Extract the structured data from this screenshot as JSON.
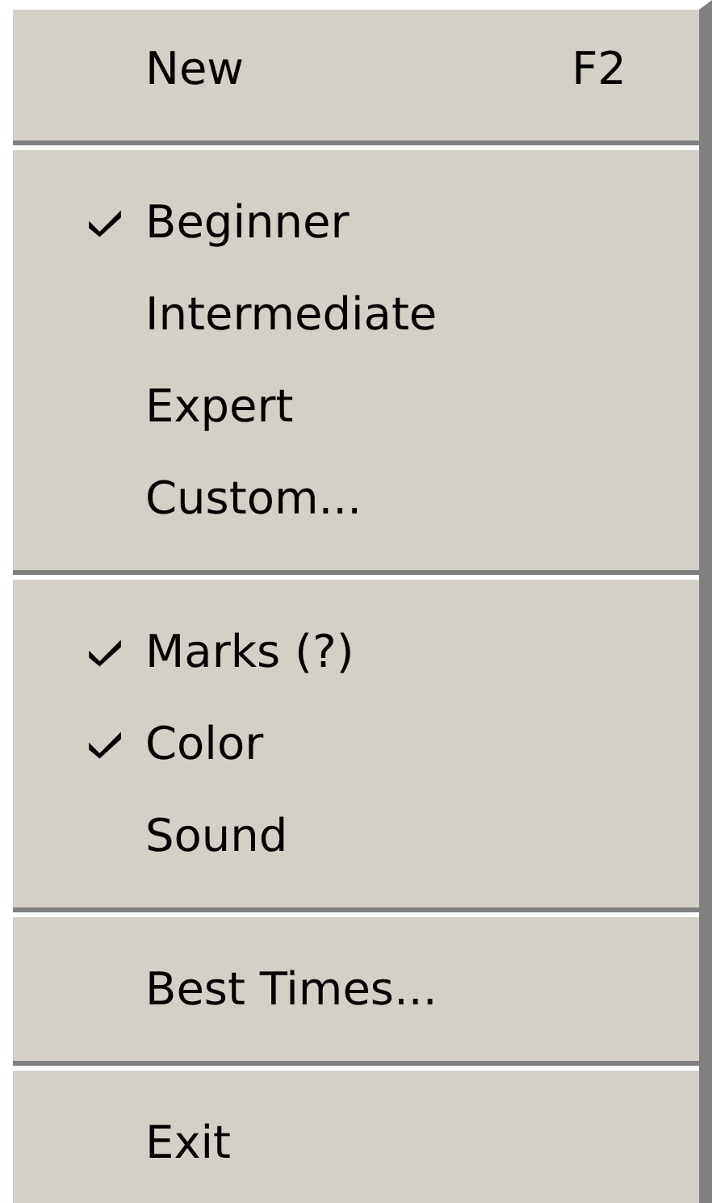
{
  "menu": {
    "items": [
      {
        "kind": "item",
        "label": "New",
        "shortcut": "F2",
        "checked": false
      },
      {
        "kind": "separator"
      },
      {
        "kind": "item",
        "label": "Beginner",
        "checked": true
      },
      {
        "kind": "item",
        "label": "Intermediate",
        "checked": false
      },
      {
        "kind": "item",
        "label": "Expert",
        "checked": false
      },
      {
        "kind": "item",
        "label": "Custom...",
        "checked": false
      },
      {
        "kind": "separator"
      },
      {
        "kind": "item",
        "label": "Marks (?)",
        "checked": true
      },
      {
        "kind": "item",
        "label": "Color",
        "checked": true
      },
      {
        "kind": "item",
        "label": "Sound",
        "checked": false
      },
      {
        "kind": "separator"
      },
      {
        "kind": "item",
        "label": "Best Times...",
        "checked": false
      },
      {
        "kind": "separator"
      },
      {
        "kind": "item",
        "label": "Exit",
        "checked": false
      }
    ]
  }
}
